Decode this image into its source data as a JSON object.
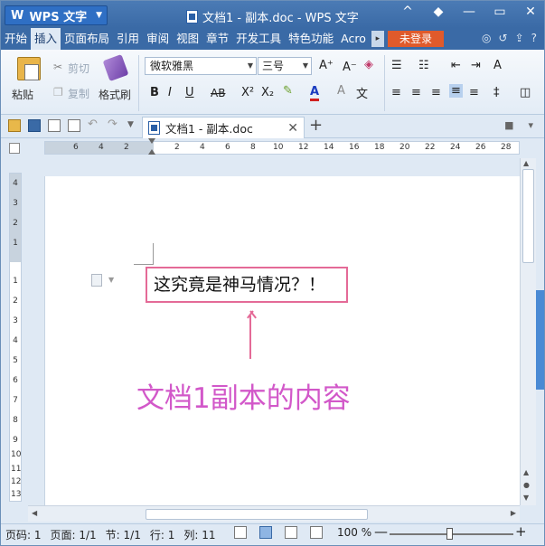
{
  "app": {
    "name": "WPS 文字",
    "logo": "W",
    "window_title": "文档1 - 副本.doc - WPS 文字"
  },
  "menu": {
    "items": [
      "开始",
      "插入",
      "页面布局",
      "引用",
      "审阅",
      "视图",
      "章节",
      "开发工具",
      "特色功能",
      "Acro"
    ],
    "active": "插入",
    "login_label": "未登录"
  },
  "ribbon": {
    "paste": "粘贴",
    "cut": "剪切",
    "copy": "复制",
    "format_painter": "格式刷",
    "font_name": "微软雅黑",
    "font_size": "三号",
    "bold": "B",
    "italic": "I",
    "underline": "U",
    "strike": "AB",
    "superscript": "X²",
    "subscript": "X₂",
    "font_color": "A",
    "pinyin": "文"
  },
  "tab": {
    "doc_title": "文档1 - 副本.doc"
  },
  "ruler": {
    "h_ticks": [
      "6",
      "4",
      "2",
      "2",
      "4",
      "6",
      "8",
      "10",
      "12",
      "14",
      "16",
      "18",
      "20",
      "22",
      "24",
      "26",
      "28"
    ],
    "v_ticks": [
      "4",
      "3",
      "2",
      "1",
      "1",
      "2",
      "3",
      "4",
      "5",
      "6",
      "7",
      "8",
      "9",
      "10",
      "11",
      "12",
      "13"
    ]
  },
  "document": {
    "content": "这究竟是神马情况？！",
    "annotation": "文档1副本的内容"
  },
  "status": {
    "page_no": "页码: 1",
    "pages": "页面: 1/1",
    "section": "节: 1/1",
    "row": "行: 1",
    "col": "列: 11",
    "zoom": "100 %"
  },
  "colors": {
    "titlebar": "#3a6aa6",
    "login": "#e05a2b",
    "highlight_box": "#e46a97",
    "annotation": "#d258c9"
  },
  "icons": [
    "wps-logo-icon",
    "doc-icon",
    "minimize-icon",
    "maximize-icon",
    "close-icon",
    "paste-icon",
    "cut-icon",
    "copy-icon",
    "format-painter-icon",
    "open-icon",
    "save-icon",
    "print-icon",
    "undo-icon",
    "redo-icon",
    "new-tab-icon"
  ]
}
